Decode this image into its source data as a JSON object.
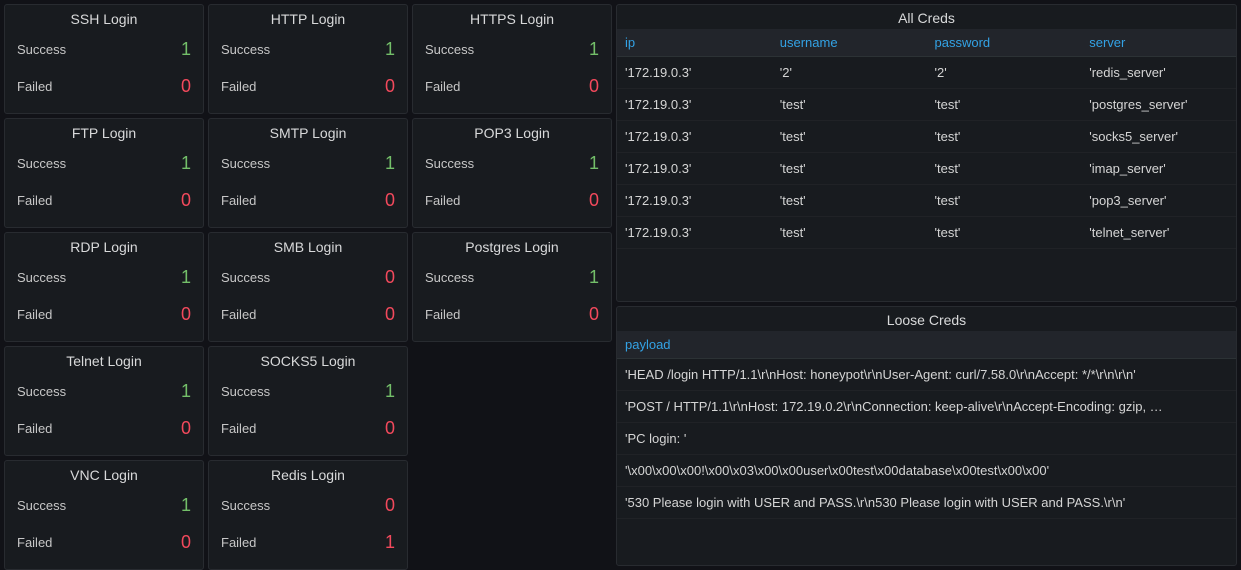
{
  "labels": {
    "success": "Success",
    "failed": "Failed"
  },
  "login_panels": [
    {
      "title": "SSH Login",
      "success": "1",
      "failed": "0"
    },
    {
      "title": "HTTP Login",
      "success": "1",
      "failed": "0"
    },
    {
      "title": "HTTPS Login",
      "success": "1",
      "failed": "0"
    },
    {
      "title": "FTP Login",
      "success": "1",
      "failed": "0"
    },
    {
      "title": "SMTP Login",
      "success": "1",
      "failed": "0"
    },
    {
      "title": "POP3 Login",
      "success": "1",
      "failed": "0"
    },
    {
      "title": "RDP Login",
      "success": "1",
      "failed": "0"
    },
    {
      "title": "SMB Login",
      "success": "0",
      "failed": "0"
    },
    {
      "title": "Postgres Login",
      "success": "1",
      "failed": "0"
    },
    {
      "title": "Telnet Login",
      "success": "1",
      "failed": "0"
    },
    {
      "title": "SOCKS5 Login",
      "success": "1",
      "failed": "0"
    },
    {
      "title": "",
      "blank": true
    },
    {
      "title": "VNC Login",
      "success": "1",
      "failed": "0"
    },
    {
      "title": "Redis Login",
      "success": "0",
      "failed": "1"
    }
  ],
  "all_creds": {
    "title": "All Creds",
    "headers": [
      "ip",
      "username",
      "password",
      "server"
    ],
    "rows": [
      [
        "'172.19.0.3'",
        "'2'",
        "'2'",
        "'redis_server'"
      ],
      [
        "'172.19.0.3'",
        "'test'",
        "'test'",
        "'postgres_server'"
      ],
      [
        "'172.19.0.3'",
        "'test'",
        "'test'",
        "'socks5_server'"
      ],
      [
        "'172.19.0.3'",
        "'test'",
        "'test'",
        "'imap_server'"
      ],
      [
        "'172.19.0.3'",
        "'test'",
        "'test'",
        "'pop3_server'"
      ],
      [
        "'172.19.0.3'",
        "'test'",
        "'test'",
        "'telnet_server'"
      ]
    ]
  },
  "loose_creds": {
    "title": "Loose Creds",
    "headers": [
      "payload"
    ],
    "rows": [
      [
        "'HEAD /login HTTP/1.1\\r\\nHost: honeypot\\r\\nUser-Agent: curl/7.58.0\\r\\nAccept: */*\\r\\n\\r\\n'"
      ],
      [
        "'POST / HTTP/1.1\\r\\nHost: 172.19.0.2\\r\\nConnection: keep-alive\\r\\nAccept-Encoding: gzip, …"
      ],
      [
        "'PC login: '"
      ],
      [
        "'\\x00\\x00\\x00!\\x00\\x03\\x00\\x00user\\x00test\\x00database\\x00test\\x00\\x00'"
      ],
      [
        "'530 Please login with USER and PASS.\\r\\n530 Please login with USER and PASS.\\r\\n'"
      ]
    ]
  }
}
